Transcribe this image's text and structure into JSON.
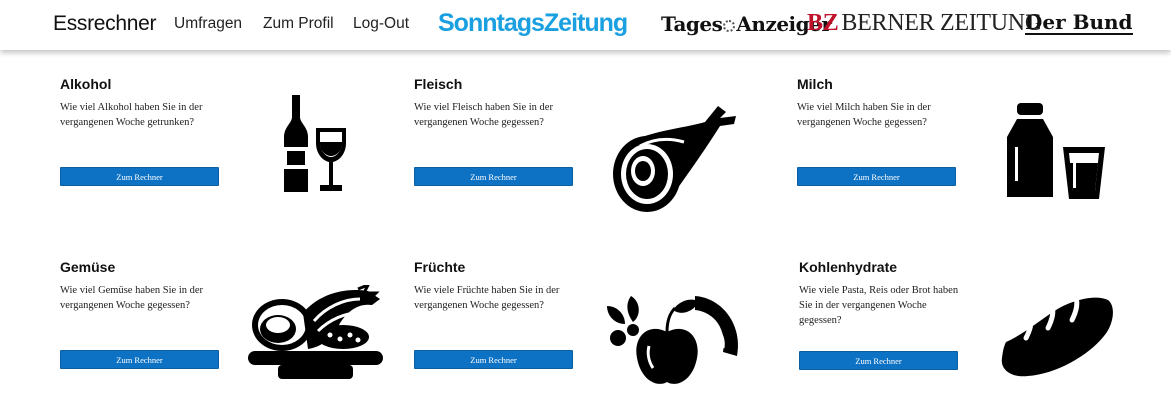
{
  "header": {
    "brand": "Essrechner",
    "nav": [
      "Umfragen",
      "Zum Profil",
      "Log-Out"
    ],
    "logos": {
      "sonntagszeitung": "SonntagsZeitung",
      "tagesanzeiger_a": "Tages",
      "tagesanzeiger_b": "Anzeiger",
      "bz_mark": "BZ",
      "bz_text": "BERNER ZEITUNG",
      "bund": "Der Bund"
    }
  },
  "colors": {
    "button": "#0e72c4",
    "sonntagszeitung": "#1aa0e0",
    "bz_red": "#c0112b"
  },
  "cards": [
    {
      "title": "Alkohol",
      "text": "Wie viel Alkohol haben Sie in der vergangenen Woche getrunken?",
      "button": "Zum Rechner",
      "icon": "bottle-glass-icon"
    },
    {
      "title": "Fleisch",
      "text": "Wie viel Fleisch haben Sie in der vergangenen Woche gegessen?",
      "button": "Zum Rechner",
      "icon": "ham-icon"
    },
    {
      "title": "Milch",
      "text": "Wie viel Milch haben Sie in der vergangenen Woche gegessen?",
      "button": "Zum Rechner",
      "icon": "milk-bottle-glass-icon"
    },
    {
      "title": "Gemüse",
      "text": "Wie viel Gemüse haben Sie in der vergangenen Woche gegessen?",
      "button": "Zum Rechner",
      "icon": "vegetables-board-icon"
    },
    {
      "title": "Früchte",
      "text": "Wie viele Früchte haben Sie in der vergangenen Woche gegessen?",
      "button": "Zum Rechner",
      "icon": "fruits-icon"
    },
    {
      "title": "Kohlenhydrate",
      "text": "Wie viele Pasta, Reis oder Brot haben Sie in der vergangenen Woche gegessen?",
      "button": "Zum Rechner",
      "icon": "bread-icon"
    }
  ]
}
